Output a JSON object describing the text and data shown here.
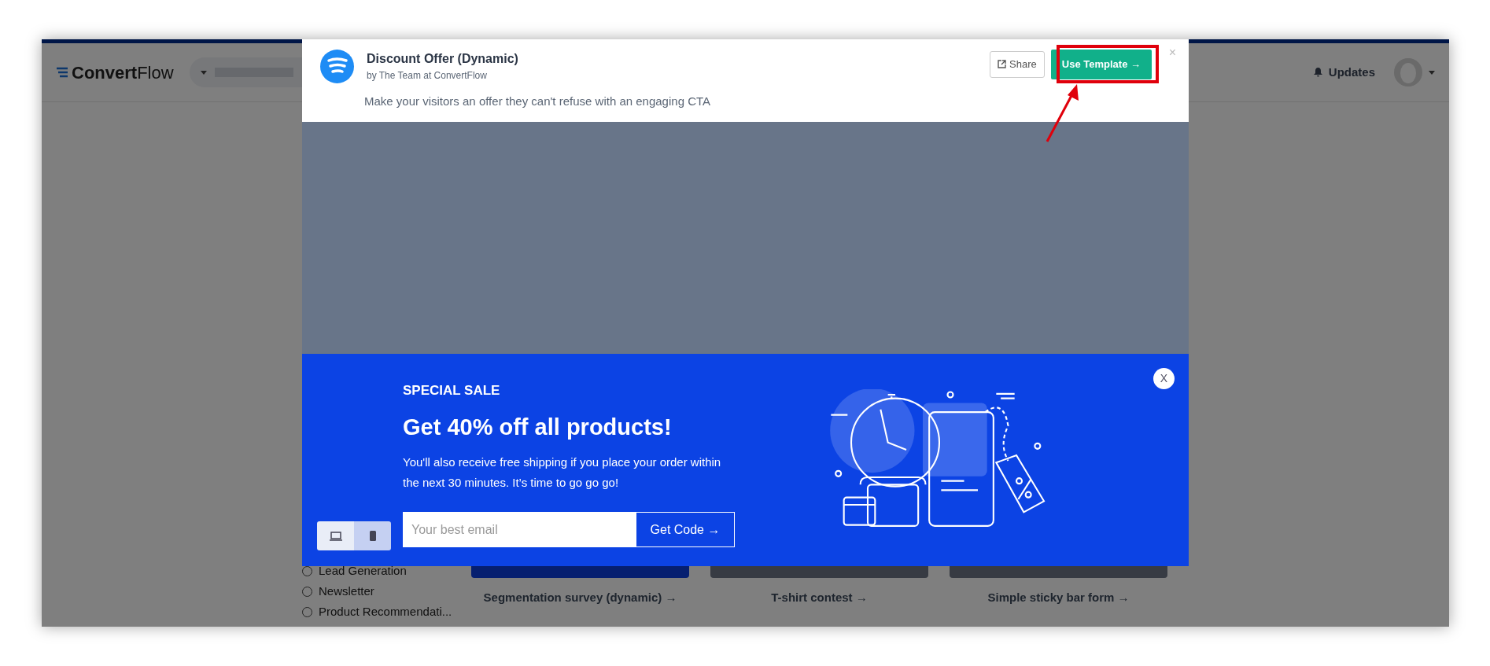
{
  "app": {
    "logo": "**Convert**Flow",
    "updates": "Updates",
    "filters": [
      {
        "label": "Lead Generation",
        "checked": false
      },
      {
        "label": "Newsletter",
        "checked": false
      },
      {
        "label": "Product Recommendati...",
        "checked": false
      }
    ],
    "templates": [
      {
        "title": "Segmentation survey (dynamic) →",
        "kind": "blue"
      },
      {
        "title": "T-shirt contest →",
        "kind": "dark"
      },
      {
        "title": "Simple sticky bar form →",
        "kind": "dark"
      }
    ]
  },
  "modal": {
    "title": "Discount Offer (Dynamic)",
    "author": "by The Team at ConvertFlow",
    "description": "Make your visitors an offer they can't refuse with an engaging CTA",
    "share": "Share",
    "use_template": "Use Template →",
    "close": "×",
    "preview": {
      "eyebrow": "SPECIAL SALE",
      "headline": "Get 40% off all products!",
      "body": "You'll also receive free shipping if you place your order within the next 30 minutes. It’s time to go go go!",
      "email_placeholder": "Your best email",
      "cta": "Get Code →",
      "close": "X",
      "devices": [
        {
          "kind": "desktop",
          "selected": false
        },
        {
          "kind": "mobile",
          "selected": true
        }
      ]
    }
  }
}
